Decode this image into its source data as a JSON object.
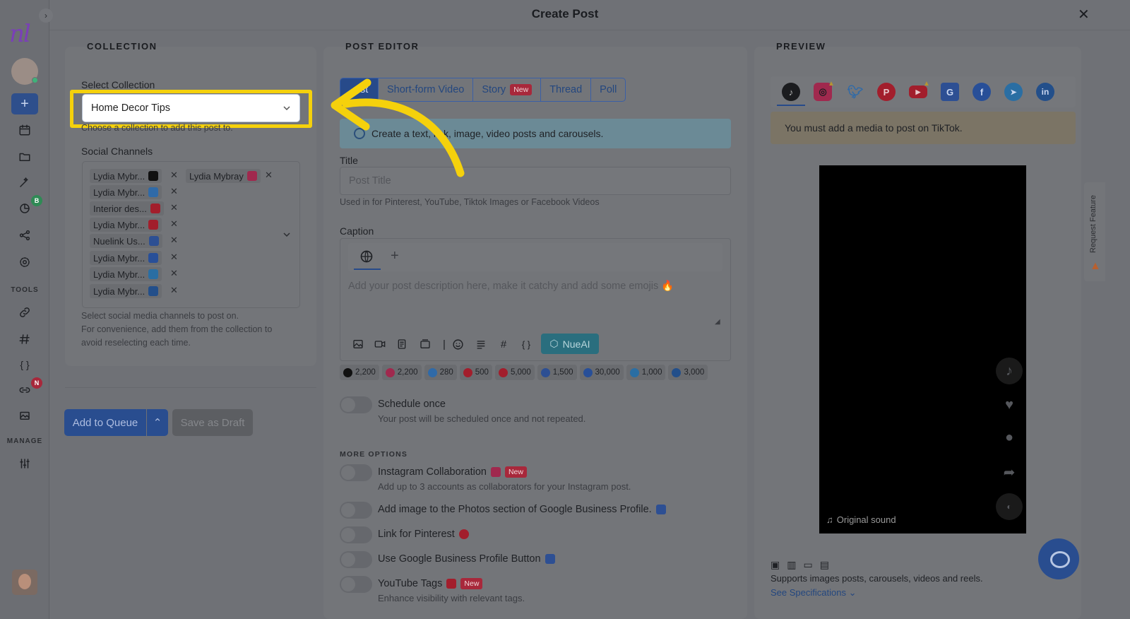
{
  "header": {
    "title": "Create Post",
    "close": "✕"
  },
  "sidebar": {
    "logo": "nl",
    "plus": "+",
    "tools_label": "TOOLS",
    "manage_label": "MANAGE",
    "badge_b": "B",
    "badge_n": "N",
    "expand": "›"
  },
  "collection": {
    "section": "COLLECTION",
    "select_label": "Select Collection",
    "selected": "Home Decor Tips",
    "select_help": "Choose a collection to add this post to.",
    "channels_label": "Social Channels",
    "channels": [
      {
        "name": "Lydia Mybr...",
        "color": "#111111"
      },
      {
        "name": "Lydia Mybray",
        "color": "#a0294e"
      },
      {
        "name": "Lydia Mybr...",
        "color": "#2f6aa8"
      },
      {
        "name": "Interior des...",
        "color": "#a21e2c"
      },
      {
        "name": "Lydia Mybr...",
        "color": "#a21e2c"
      },
      {
        "name": "Nuelink Us...",
        "color": "#2d4f93"
      },
      {
        "name": "Lydia Mybr...",
        "color": "#284f98"
      },
      {
        "name": "Lydia Mybr...",
        "color": "#2a6ea3"
      },
      {
        "name": "Lydia Mybr...",
        "color": "#234f8a"
      }
    ],
    "channels_help_1": "Select social media channels to post on.",
    "channels_help_2": "For convenience, add them from the collection to",
    "channels_help_3": "avoid reselecting each time.",
    "add_queue": "Add to Queue",
    "save_draft": "Save as Draft"
  },
  "editor": {
    "section": "POST EDITOR",
    "tabs": [
      "Post",
      "Short-form Video",
      "Story",
      "Thread",
      "Poll"
    ],
    "tab_post_visible": "st",
    "new_badge": "New",
    "info": "Create a text, link, image, video posts and carousels.",
    "title_label": "Title",
    "title_placeholder": "Post Title",
    "title_help": "Used in for Pinterest, YouTube, Tiktok Images or Facebook Videos",
    "caption_label": "Caption",
    "caption_placeholder": "Add your post description here, make it catchy and add some emojis 🔥",
    "nueai": "NueAI",
    "counters": [
      {
        "value": "2,200",
        "color": "#111111"
      },
      {
        "value": "2,200",
        "color": "#a0294e"
      },
      {
        "value": "280",
        "color": "#2f6aa8"
      },
      {
        "value": "500",
        "color": "#a21e2c"
      },
      {
        "value": "5,000",
        "color": "#a21e2c"
      },
      {
        "value": "1,500",
        "color": "#2d4f93"
      },
      {
        "value": "30,000",
        "color": "#284f98"
      },
      {
        "value": "1,000",
        "color": "#2a6ea3"
      },
      {
        "value": "3,000",
        "color": "#234f8a"
      }
    ],
    "schedule_once": "Schedule once",
    "schedule_help": "Your post will be scheduled once and not repeated.",
    "more_options": "MORE OPTIONS",
    "ig_collab": "Instagram Collaboration",
    "ig_collab_help": "Add up to 3 accounts as collaborators for your Instagram post.",
    "gbp_photos": "Add image to the Photos section of Google Business Profile.",
    "pinterest_link": "Link for Pinterest",
    "gbp_button": "Use Google Business Profile Button",
    "yt_tags": "YouTube Tags",
    "yt_tags_help": "Enhance visibility with relevant tags."
  },
  "preview": {
    "section": "PREVIEW",
    "networks": [
      "tiktok-icon",
      "instagram-icon",
      "twitter-icon",
      "pinterest-icon",
      "youtube-icon",
      "google-business-icon",
      "facebook-icon",
      "telegram-icon",
      "linkedin-icon"
    ],
    "warning": "You must add a media to post on TikTok.",
    "original_sound": "Original sound",
    "supports": "Supports images posts, carousels, videos and reels.",
    "see_specs": "See Specifications",
    "request_feature": "Request Feature"
  },
  "colors": {
    "highlight": "#f5d10c",
    "arrow": "#f5d10c",
    "primary": "#294d8f",
    "new_badge": "#a8283b"
  }
}
